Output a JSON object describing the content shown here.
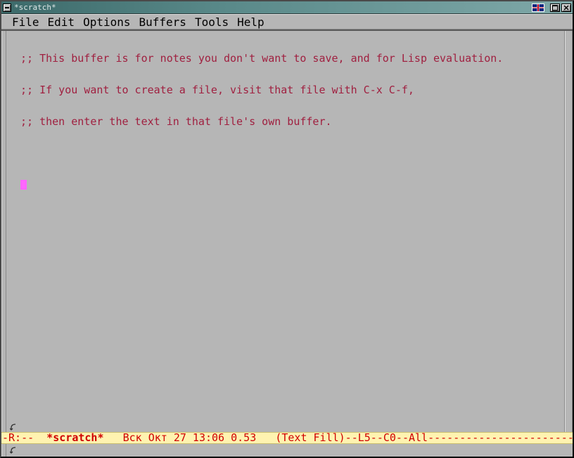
{
  "window": {
    "title": "*scratch*"
  },
  "menu": {
    "file": "File",
    "edit": "Edit",
    "options": "Options",
    "buffers": "Buffers",
    "tools": "Tools",
    "help": "Help"
  },
  "buffer": {
    "line1": ";; This buffer is for notes you don't want to save, and for Lisp evaluation.",
    "line2": ";; If you want to create a file, visit that file with C-x C-f,",
    "line3": ";; then enter the text in that file's own buffer."
  },
  "modeline": {
    "left": "-R:--  ",
    "buffer_name": "*scratch*",
    "center": "   Вск Окт 27 13:06 0.53   (Text Fill)--L5--C0--All",
    "trail": "------------------------"
  }
}
